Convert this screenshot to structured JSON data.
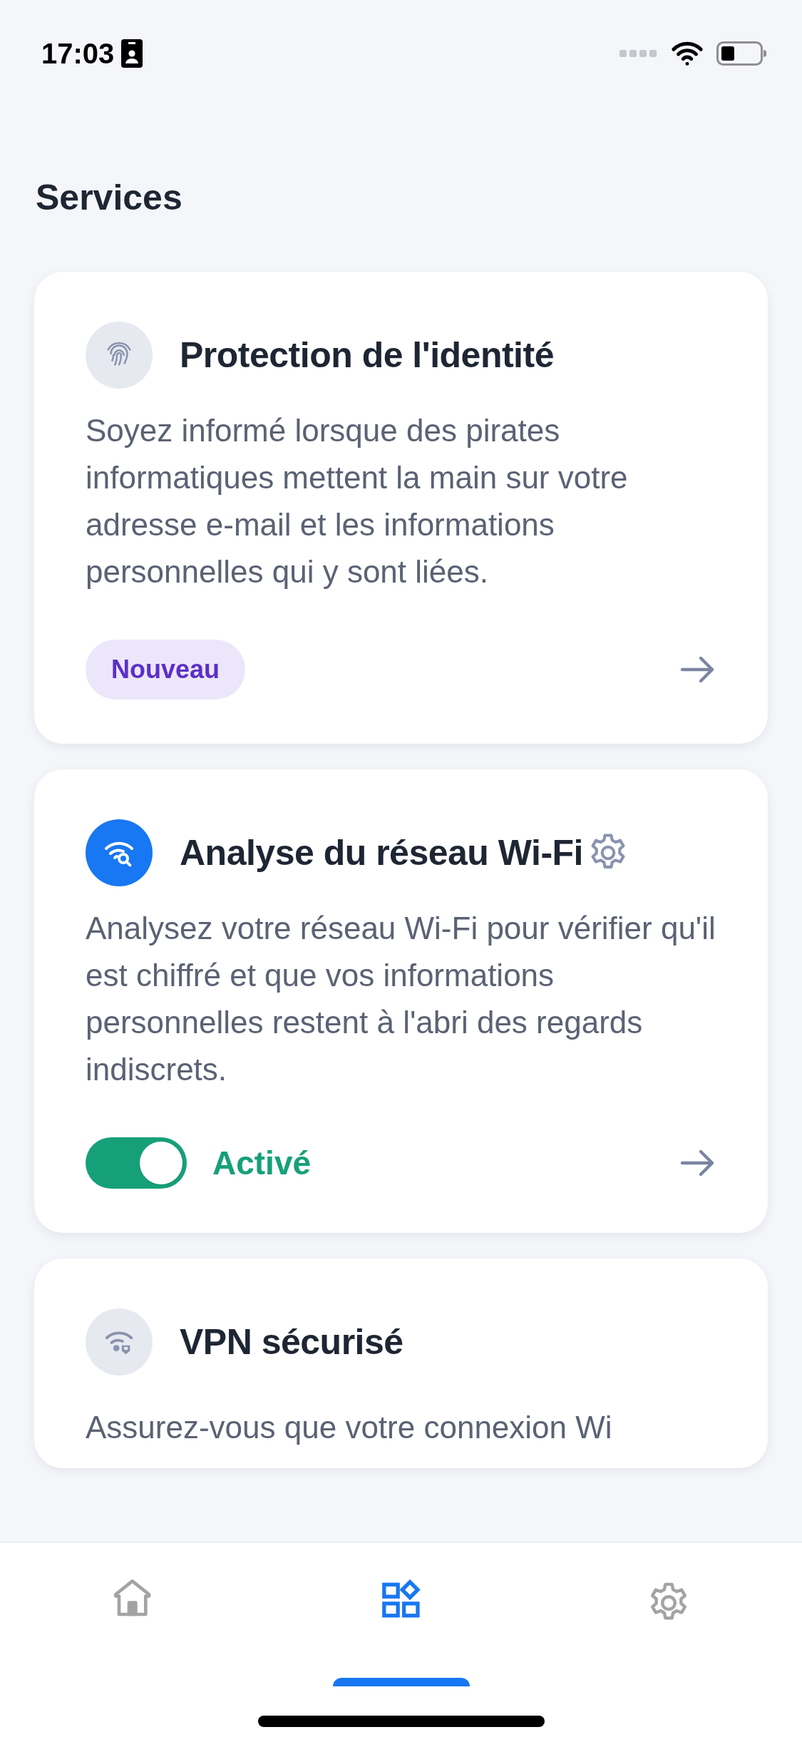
{
  "status_bar": {
    "time": "17:03"
  },
  "title": "Services",
  "services": [
    {
      "kind": "badge",
      "title": "Protection de l'identité",
      "description": "Soyez informé lorsque des pirates informatiques mettent la main sur votre adresse e-mail et les informations personnelles qui y sont liées.",
      "badge": "Nouveau"
    },
    {
      "kind": "toggle",
      "title": "Analyse du réseau Wi-Fi",
      "description": "Analysez votre réseau Wi-Fi pour vérifier qu'il est chiffré et que vos informations personnelles restent à l'abri des regards indiscrets.",
      "on": true,
      "status": "Activé"
    },
    {
      "kind": "partial",
      "title": "VPN sécurisé",
      "description": "Assurez-vous que votre connexion Wi"
    }
  ],
  "nav": [
    {
      "selected": false
    },
    {
      "selected": true
    },
    {
      "selected": false
    }
  ]
}
